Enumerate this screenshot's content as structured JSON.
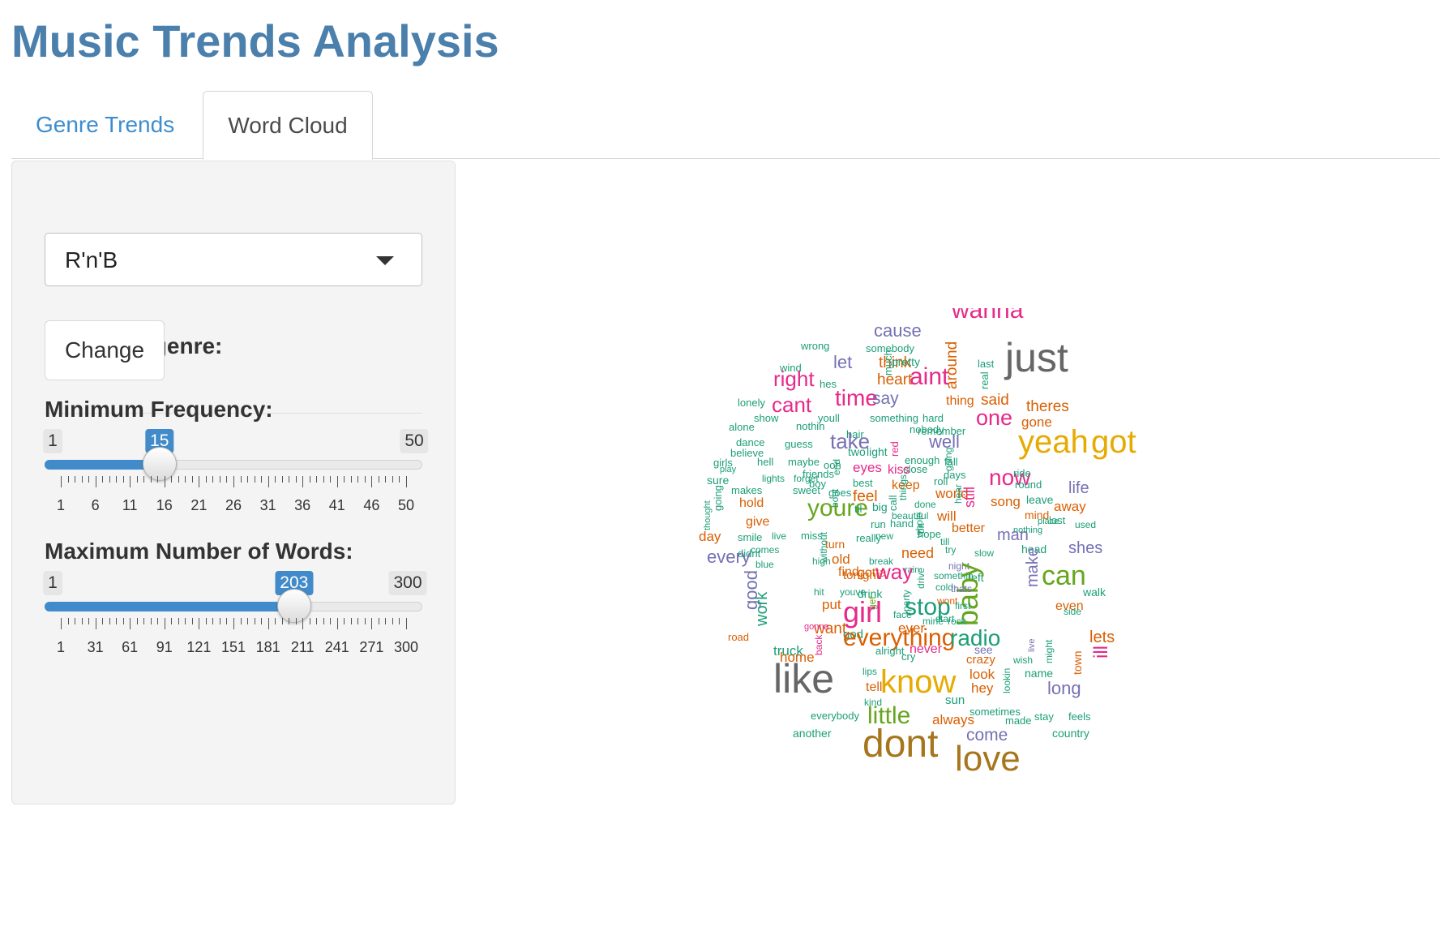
{
  "app": {
    "title": "Music Trends Analysis"
  },
  "tabs": [
    {
      "label": "Genre Trends",
      "active": false
    },
    {
      "label": "Word Cloud",
      "active": true
    }
  ],
  "sidebar": {
    "genre_label": "Choose a genre:",
    "genre_value": "R'n'B",
    "change_button": "Change",
    "min_freq": {
      "label": "Minimum Frequency:",
      "min": 1,
      "max": 50,
      "value": 15,
      "min_label": "1",
      "max_label": "50",
      "value_label": "15",
      "tick_labels": [
        "1",
        "6",
        "11",
        "16",
        "21",
        "26",
        "31",
        "36",
        "41",
        "46",
        "50"
      ]
    },
    "max_words": {
      "label": "Maximum Number of Words:",
      "min": 1,
      "max": 300,
      "value": 203,
      "min_label": "1",
      "max_label": "300",
      "value_label": "203",
      "tick_labels": [
        "1",
        "31",
        "61",
        "91",
        "121",
        "151",
        "181",
        "211",
        "241",
        "271",
        "300"
      ]
    }
  },
  "colors": {
    "green": "#1b9e77",
    "orange": "#d95f02",
    "purple": "#7570b3",
    "pink": "#e7298a",
    "lime": "#66a61e",
    "yellow": "#e6ab02",
    "brown": "#a6761d",
    "gray": "#666666",
    "accent": "#428bca",
    "title": "#4b7fac"
  },
  "word_cloud": [
    [
      "wanna",
      "pink"
    ],
    [
      "cause",
      "purple"
    ],
    [
      "wrong",
      "green"
    ],
    [
      "somebody",
      "green"
    ],
    [
      "just",
      "gray"
    ],
    [
      "wind",
      "green"
    ],
    [
      "let",
      "purple"
    ],
    [
      "think",
      "orange"
    ],
    [
      "much",
      "green"
    ],
    [
      "pretty",
      "green"
    ],
    [
      "around",
      "orange"
    ],
    [
      "last",
      "green"
    ],
    [
      "real",
      "green"
    ],
    [
      "right",
      "pink"
    ],
    [
      "hes",
      "green"
    ],
    [
      "heart",
      "orange"
    ],
    [
      "aint",
      "pink"
    ],
    [
      "time",
      "pink"
    ],
    [
      "lonely",
      "green"
    ],
    [
      "cant",
      "pink"
    ],
    [
      "say",
      "purple"
    ],
    [
      "thing",
      "orange"
    ],
    [
      "said",
      "orange"
    ],
    [
      "theres",
      "orange"
    ],
    [
      "show",
      "green"
    ],
    [
      "youll",
      "green"
    ],
    [
      "something",
      "green"
    ],
    [
      "hard",
      "green"
    ],
    [
      "one",
      "pink"
    ],
    [
      "gone",
      "orange"
    ],
    [
      "alone",
      "green"
    ],
    [
      "nothin",
      "green"
    ],
    [
      "hair",
      "green"
    ],
    [
      "nobody",
      "green"
    ],
    [
      "remember",
      "green"
    ],
    [
      "take",
      "purple"
    ],
    [
      "red",
      "pink"
    ],
    [
      "well",
      "purple"
    ],
    [
      "yeah",
      "yellow"
    ],
    [
      "got",
      "yellow"
    ],
    [
      "dance",
      "green"
    ],
    [
      "guess",
      "green"
    ],
    [
      "believe",
      "green"
    ],
    [
      "two",
      "green"
    ],
    [
      "light",
      "green"
    ],
    [
      "going",
      "green"
    ],
    [
      "girls",
      "green"
    ],
    [
      "hell",
      "green"
    ],
    [
      "maybe",
      "green"
    ],
    [
      "ooh",
      "green"
    ],
    [
      "end",
      "green"
    ],
    [
      "enough",
      "green"
    ],
    [
      "fall",
      "green"
    ],
    [
      "play",
      "green"
    ],
    [
      "eyes",
      "pink"
    ],
    [
      "friends",
      "green"
    ],
    [
      "close",
      "green"
    ],
    [
      "days",
      "green"
    ],
    [
      "now",
      "pink"
    ],
    [
      "sure",
      "green"
    ],
    [
      "lights",
      "green"
    ],
    [
      "forget",
      "green"
    ],
    [
      "boy",
      "green"
    ],
    [
      "kiss",
      "pink"
    ],
    [
      "roll",
      "green"
    ],
    [
      "ride",
      "green"
    ],
    [
      "round",
      "green"
    ],
    [
      "life",
      "purple"
    ],
    [
      "makes",
      "green"
    ],
    [
      "sweet",
      "green"
    ],
    [
      "best",
      "green"
    ],
    [
      "keep",
      "orange"
    ],
    [
      "things",
      "green"
    ],
    [
      "world",
      "orange"
    ],
    [
      "goes",
      "green"
    ],
    [
      "feel",
      "orange"
    ],
    [
      "song",
      "orange"
    ],
    [
      "leave",
      "green"
    ],
    [
      "away",
      "orange"
    ],
    [
      "hold",
      "orange"
    ],
    [
      "bout",
      "green"
    ],
    [
      "youre",
      "lime"
    ],
    [
      "til",
      "green"
    ],
    [
      "big",
      "green"
    ],
    [
      "call",
      "green"
    ],
    [
      "done",
      "green"
    ],
    [
      "still",
      "pink"
    ],
    [
      "hear",
      "green"
    ],
    [
      "mind",
      "orange"
    ],
    [
      "thought",
      "green"
    ],
    [
      "beautiful",
      "green"
    ],
    [
      "will",
      "orange"
    ],
    [
      "give",
      "orange"
    ],
    [
      "going",
      "green"
    ],
    [
      "run",
      "green"
    ],
    [
      "hand",
      "green"
    ],
    [
      "lost",
      "green"
    ],
    [
      "used",
      "green"
    ],
    [
      "day",
      "orange"
    ],
    [
      "smile",
      "green"
    ],
    [
      "live",
      "green"
    ],
    [
      "miss",
      "green"
    ],
    [
      "new",
      "green"
    ],
    [
      "bit",
      "green"
    ],
    [
      "better",
      "orange"
    ],
    [
      "nothing",
      "green"
    ],
    [
      "place",
      "green"
    ],
    [
      "man",
      "purple"
    ],
    [
      "turn",
      "orange"
    ],
    [
      "without",
      "green"
    ],
    [
      "really",
      "green"
    ],
    [
      "hope",
      "green"
    ],
    [
      "till",
      "green"
    ],
    [
      "didnt",
      "green"
    ],
    [
      "comes",
      "green"
    ],
    [
      "whole",
      "green"
    ],
    [
      "need",
      "orange"
    ],
    [
      "try",
      "green"
    ],
    [
      "slow",
      "green"
    ],
    [
      "head",
      "green"
    ],
    [
      "shes",
      "purple"
    ],
    [
      "every",
      "purple"
    ],
    [
      "blue",
      "green"
    ],
    [
      "high",
      "green"
    ],
    [
      "old",
      "orange"
    ],
    [
      "break",
      "green"
    ],
    [
      "find",
      "orange"
    ],
    [
      "gotta",
      "orange"
    ],
    [
      "rain",
      "green"
    ],
    [
      "night",
      "purple"
    ],
    [
      "tonight",
      "orange"
    ],
    [
      "way",
      "pink"
    ],
    [
      "somethin",
      "green"
    ],
    [
      "left",
      "green"
    ],
    [
      "baby",
      "lime"
    ],
    [
      "make",
      "purple"
    ],
    [
      "can",
      "lime"
    ],
    [
      "good",
      "purple"
    ],
    [
      "walk",
      "green"
    ],
    [
      "hit",
      "green"
    ],
    [
      "youve",
      "green"
    ],
    [
      "drive",
      "green"
    ],
    [
      "cold",
      "green"
    ],
    [
      "thats",
      "purple"
    ],
    [
      "work",
      "green"
    ],
    [
      "drink",
      "green"
    ],
    [
      "get",
      "lime"
    ],
    [
      "girl",
      "pink"
    ],
    [
      "stop",
      "green"
    ],
    [
      "party",
      "green"
    ],
    [
      "wont",
      "orange"
    ],
    [
      "put",
      "orange"
    ],
    [
      "face",
      "green"
    ],
    [
      "start",
      "green"
    ],
    [
      "first",
      "green"
    ],
    [
      "even",
      "orange"
    ],
    [
      "side",
      "green"
    ],
    [
      "ill",
      "pink"
    ],
    [
      "want",
      "orange"
    ],
    [
      "ever",
      "orange"
    ],
    [
      "mine",
      "green"
    ],
    [
      "rock",
      "green"
    ],
    [
      "gonna",
      "pink"
    ],
    [
      "god",
      "green"
    ],
    [
      "road",
      "orange"
    ],
    [
      "back",
      "pink"
    ],
    [
      "everything",
      "orange"
    ],
    [
      "never",
      "pink"
    ],
    [
      "radio",
      "green"
    ],
    [
      "live",
      "purple"
    ],
    [
      "lets",
      "orange"
    ],
    [
      "truck",
      "green"
    ],
    [
      "home",
      "orange"
    ],
    [
      "alright",
      "green"
    ],
    [
      "see",
      "purple"
    ],
    [
      "cry",
      "green"
    ],
    [
      "crazy",
      "orange"
    ],
    [
      "wish",
      "green"
    ],
    [
      "might",
      "green"
    ],
    [
      "town",
      "orange"
    ],
    [
      "like",
      "gray"
    ],
    [
      "know",
      "yellow"
    ],
    [
      "lips",
      "green"
    ],
    [
      "look",
      "orange"
    ],
    [
      "name",
      "green"
    ],
    [
      "lookin",
      "green"
    ],
    [
      "tell",
      "orange"
    ],
    [
      "hey",
      "orange"
    ],
    [
      "long",
      "purple"
    ],
    [
      "kind",
      "green"
    ],
    [
      "sun",
      "green"
    ],
    [
      "everybody",
      "green"
    ],
    [
      "little",
      "lime"
    ],
    [
      "always",
      "orange"
    ],
    [
      "sometimes",
      "green"
    ],
    [
      "made",
      "green"
    ],
    [
      "stay",
      "green"
    ],
    [
      "feels",
      "green"
    ],
    [
      "another",
      "green"
    ],
    [
      "dont",
      "brown"
    ],
    [
      "come",
      "purple"
    ],
    [
      "country",
      "green"
    ],
    [
      "love",
      "brown"
    ]
  ]
}
